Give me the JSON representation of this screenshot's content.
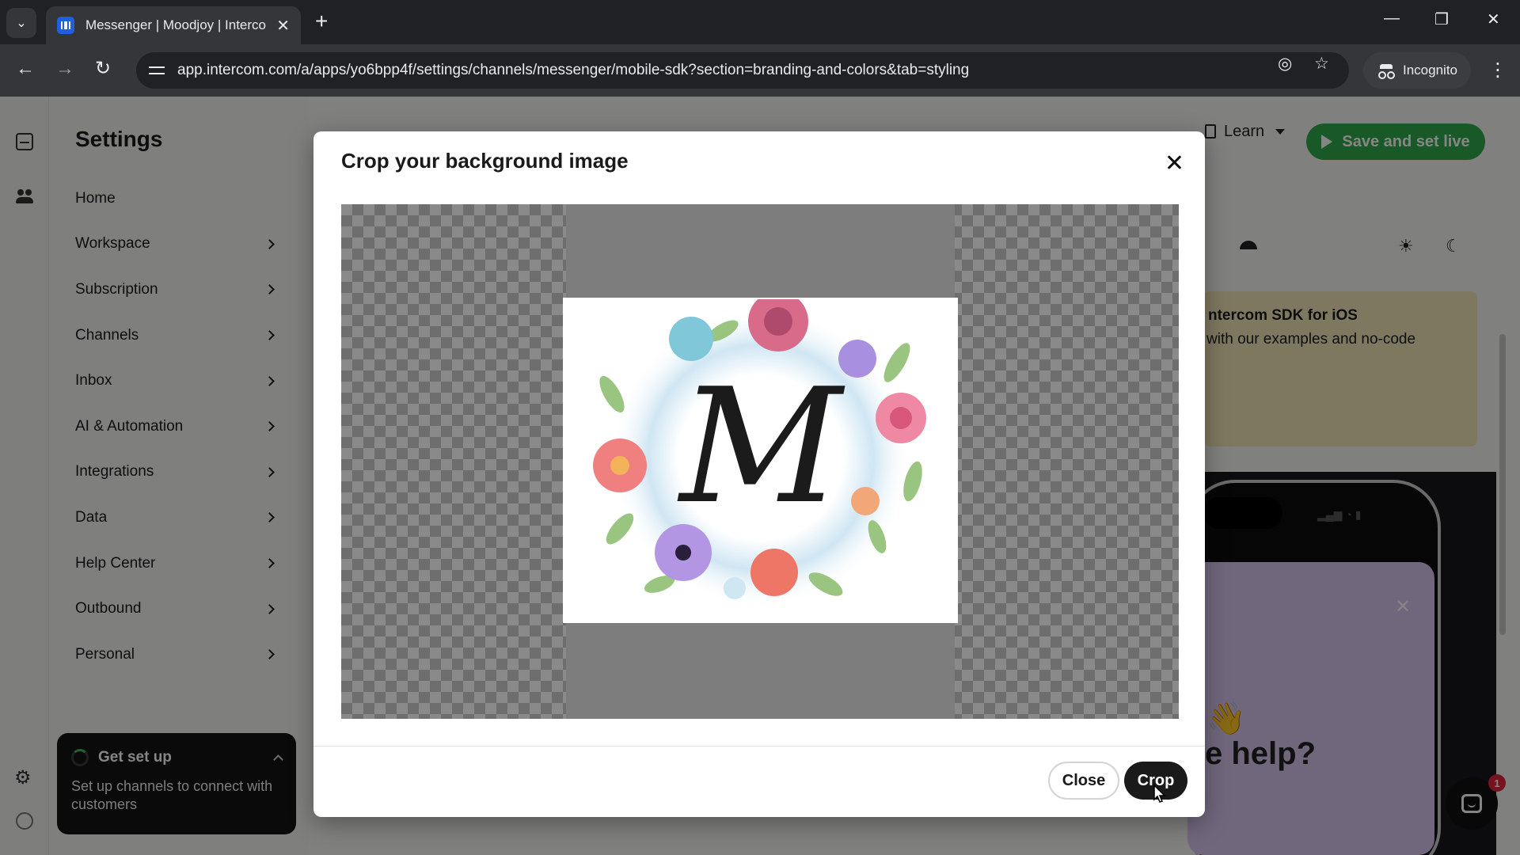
{
  "browser": {
    "tab_title": "Messenger | Moodjoy | Interco",
    "url": "app.intercom.com/a/apps/yo6bpp4f/settings/channels/messenger/mobile-sdk?section=branding-and-colors&tab=styling",
    "incognito_label": "Incognito",
    "icons": [
      "tab-search-icon",
      "close-icon",
      "plus-icon",
      "minimize-icon",
      "restore-icon",
      "back-icon",
      "forward-icon",
      "reload-icon",
      "eye-off-icon",
      "star-icon",
      "incognito-icon",
      "more-vert-icon"
    ]
  },
  "sidebar": {
    "title": "Settings",
    "items": [
      {
        "label": "Home",
        "has_chevron": false
      },
      {
        "label": "Workspace",
        "has_chevron": true
      },
      {
        "label": "Subscription",
        "has_chevron": true
      },
      {
        "label": "Channels",
        "has_chevron": true
      },
      {
        "label": "Inbox",
        "has_chevron": true
      },
      {
        "label": "AI & Automation",
        "has_chevron": true
      },
      {
        "label": "Integrations",
        "has_chevron": true
      },
      {
        "label": "Data",
        "has_chevron": true
      },
      {
        "label": "Help Center",
        "has_chevron": true
      },
      {
        "label": "Outbound",
        "has_chevron": true
      },
      {
        "label": "Personal",
        "has_chevron": true
      }
    ]
  },
  "get_set_up": {
    "title": "Get set up",
    "description": "Set up channels to connect with customers"
  },
  "header": {
    "learn_label": "Learn",
    "save_label": "Save and set live"
  },
  "preview": {
    "card_title": "ntercom SDK for iOS",
    "card_text": "with our examples and no-code",
    "help_text": "e help?",
    "wave_emoji": "👋",
    "notification_count": "1"
  },
  "modal": {
    "title": "Crop your background image",
    "close_label": "Close",
    "crop_label": "Crop",
    "image_monogram": "M"
  },
  "colors": {
    "accent_green": "#2eab4b",
    "crop_button": "#1a1a1a",
    "badge_red": "#e0263a"
  }
}
